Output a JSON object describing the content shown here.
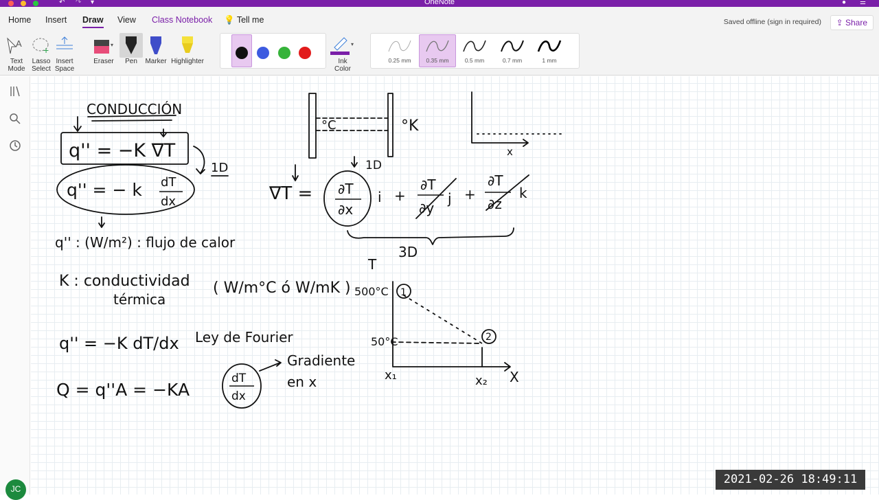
{
  "app": {
    "title": "OneNote",
    "saved_status": "Saved offline (sign in required)",
    "share_label": "Share"
  },
  "tabs": [
    {
      "label": "Home",
      "active": false
    },
    {
      "label": "Insert",
      "active": false
    },
    {
      "label": "Draw",
      "active": true
    },
    {
      "label": "View",
      "active": false
    },
    {
      "label": "Class Notebook",
      "active": false
    },
    {
      "label": "Tell me",
      "active": false
    }
  ],
  "ribbon": {
    "text_mode": "Text\nMode",
    "lasso_select": "Lasso\nSelect",
    "insert_space": "Insert\nSpace",
    "eraser": "Eraser",
    "pen": "Pen",
    "marker": "Marker",
    "highlighter": "Highlighter",
    "ink_color": "Ink\nColor",
    "colors": [
      "#111111",
      "#3d5be0",
      "#36b33a",
      "#e21b1b"
    ],
    "pen_widths": [
      "0.25 mm",
      "0.35 mm",
      "0.5 mm",
      "0.7 mm",
      "1 mm"
    ],
    "selected_width": "0.35 mm"
  },
  "user": {
    "initials": "JC"
  },
  "timestamp": "2021-02-26  18:49:11",
  "notes": {
    "title": "CONDUCCIÓN",
    "eq1": "q'' = −K ∇T",
    "label_1d": "1D",
    "eq2_lhs": "q'' = − k",
    "eq2_num": "dT",
    "eq2_den": "dx",
    "flux_def": "q'' : (W/m²) : flujo de calor",
    "k_label": "K : conductividad",
    "k_label2": "térmica",
    "k_units": "( W/m°C ó W/mK )",
    "fourier": "q'' = −K dT/dx",
    "fourier_name": "Ley de Fourier",
    "Q_eq": "Q = q''A = −KA",
    "gradient": "Gradiente",
    "gradient2": "en x",
    "grad_lhs": "∇T =",
    "d_T": "∂T",
    "d_x": "∂x",
    "d_y": "∂y",
    "d_z": "∂z",
    "i": "i",
    "j": "j",
    "k": "k",
    "plus": "+",
    "label_3d": "3D",
    "label_1d_b": "1D",
    "slab_left": "°C",
    "slab_right": "°K",
    "x_label": "x",
    "T_label": "T",
    "T1": "500°C",
    "T2": "50°C",
    "pt1": "1",
    "pt2": "2",
    "x1": "x₁",
    "x2": "x₂",
    "X": "X"
  }
}
